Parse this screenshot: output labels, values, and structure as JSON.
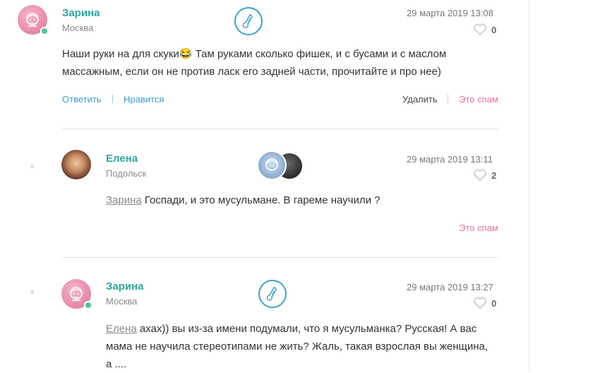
{
  "comments": [
    {
      "author": "Зарина",
      "city": "Москва",
      "date": "29 марта 2019 13:08",
      "likes": "0",
      "text": "Наши руки на для скуки😂 Там руками сколько фишек, и с бусами и с маслом массажным, если он не против ласк его задней части, прочитайте и про нее)",
      "actions": {
        "reply": "Ответить",
        "like": "Нравится",
        "delete": "Удалить",
        "spam": "Это спам"
      }
    },
    {
      "author": "Елена",
      "city": "Подольск",
      "date": "29 марта 2019 13:11",
      "likes": "2",
      "mention": "Зарина",
      "text": " Госпади, и это мусульмане. В гареме научили ?",
      "actions": {
        "spam": "Это спам"
      }
    },
    {
      "author": "Зарина",
      "city": "Москва",
      "date": "29 марта 2019 13:27",
      "likes": "0",
      "mention": "Елена",
      "text_line1": " ахах)) вы из-за имени подумали, что я мусульманка? Русская! А вас",
      "text_line2": "мама не научила стереотипами не жить? Жаль, такая взрослая вы женщина,",
      "text_line3": "а ...."
    }
  ],
  "colors": {
    "accent_teal": "#2fa6a0",
    "link_blue": "#3b9bc9",
    "spam_pink": "#e5739a",
    "online_green": "#4fc3a1"
  },
  "icons": [
    "avatar-placeholder-icon",
    "thermometer-badge-icon",
    "heart-icon"
  ]
}
